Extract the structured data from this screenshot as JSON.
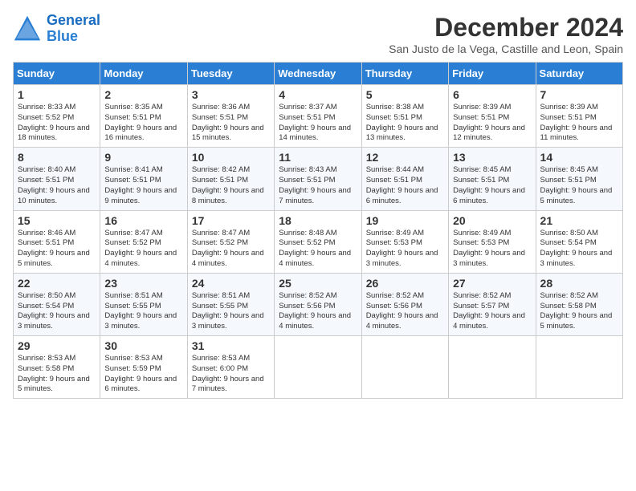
{
  "header": {
    "logo_line1": "General",
    "logo_line2": "Blue",
    "month_title": "December 2024",
    "subtitle": "San Justo de la Vega, Castille and Leon, Spain"
  },
  "columns": [
    "Sunday",
    "Monday",
    "Tuesday",
    "Wednesday",
    "Thursday",
    "Friday",
    "Saturday"
  ],
  "weeks": [
    [
      {
        "day": "1",
        "sunrise": "8:33 AM",
        "sunset": "5:52 PM",
        "daylight": "9 hours and 18 minutes."
      },
      {
        "day": "2",
        "sunrise": "8:35 AM",
        "sunset": "5:51 PM",
        "daylight": "9 hours and 16 minutes."
      },
      {
        "day": "3",
        "sunrise": "8:36 AM",
        "sunset": "5:51 PM",
        "daylight": "9 hours and 15 minutes."
      },
      {
        "day": "4",
        "sunrise": "8:37 AM",
        "sunset": "5:51 PM",
        "daylight": "9 hours and 14 minutes."
      },
      {
        "day": "5",
        "sunrise": "8:38 AM",
        "sunset": "5:51 PM",
        "daylight": "9 hours and 13 minutes."
      },
      {
        "day": "6",
        "sunrise": "8:39 AM",
        "sunset": "5:51 PM",
        "daylight": "9 hours and 12 minutes."
      },
      {
        "day": "7",
        "sunrise": "8:39 AM",
        "sunset": "5:51 PM",
        "daylight": "9 hours and 11 minutes."
      }
    ],
    [
      {
        "day": "8",
        "sunrise": "8:40 AM",
        "sunset": "5:51 PM",
        "daylight": "9 hours and 10 minutes."
      },
      {
        "day": "9",
        "sunrise": "8:41 AM",
        "sunset": "5:51 PM",
        "daylight": "9 hours and 9 minutes."
      },
      {
        "day": "10",
        "sunrise": "8:42 AM",
        "sunset": "5:51 PM",
        "daylight": "9 hours and 8 minutes."
      },
      {
        "day": "11",
        "sunrise": "8:43 AM",
        "sunset": "5:51 PM",
        "daylight": "9 hours and 7 minutes."
      },
      {
        "day": "12",
        "sunrise": "8:44 AM",
        "sunset": "5:51 PM",
        "daylight": "9 hours and 6 minutes."
      },
      {
        "day": "13",
        "sunrise": "8:45 AM",
        "sunset": "5:51 PM",
        "daylight": "9 hours and 6 minutes."
      },
      {
        "day": "14",
        "sunrise": "8:45 AM",
        "sunset": "5:51 PM",
        "daylight": "9 hours and 5 minutes."
      }
    ],
    [
      {
        "day": "15",
        "sunrise": "8:46 AM",
        "sunset": "5:51 PM",
        "daylight": "9 hours and 5 minutes."
      },
      {
        "day": "16",
        "sunrise": "8:47 AM",
        "sunset": "5:52 PM",
        "daylight": "9 hours and 4 minutes."
      },
      {
        "day": "17",
        "sunrise": "8:47 AM",
        "sunset": "5:52 PM",
        "daylight": "9 hours and 4 minutes."
      },
      {
        "day": "18",
        "sunrise": "8:48 AM",
        "sunset": "5:52 PM",
        "daylight": "9 hours and 4 minutes."
      },
      {
        "day": "19",
        "sunrise": "8:49 AM",
        "sunset": "5:53 PM",
        "daylight": "9 hours and 3 minutes."
      },
      {
        "day": "20",
        "sunrise": "8:49 AM",
        "sunset": "5:53 PM",
        "daylight": "9 hours and 3 minutes."
      },
      {
        "day": "21",
        "sunrise": "8:50 AM",
        "sunset": "5:54 PM",
        "daylight": "9 hours and 3 minutes."
      }
    ],
    [
      {
        "day": "22",
        "sunrise": "8:50 AM",
        "sunset": "5:54 PM",
        "daylight": "9 hours and 3 minutes."
      },
      {
        "day": "23",
        "sunrise": "8:51 AM",
        "sunset": "5:55 PM",
        "daylight": "9 hours and 3 minutes."
      },
      {
        "day": "24",
        "sunrise": "8:51 AM",
        "sunset": "5:55 PM",
        "daylight": "9 hours and 3 minutes."
      },
      {
        "day": "25",
        "sunrise": "8:52 AM",
        "sunset": "5:56 PM",
        "daylight": "9 hours and 4 minutes."
      },
      {
        "day": "26",
        "sunrise": "8:52 AM",
        "sunset": "5:56 PM",
        "daylight": "9 hours and 4 minutes."
      },
      {
        "day": "27",
        "sunrise": "8:52 AM",
        "sunset": "5:57 PM",
        "daylight": "9 hours and 4 minutes."
      },
      {
        "day": "28",
        "sunrise": "8:52 AM",
        "sunset": "5:58 PM",
        "daylight": "9 hours and 5 minutes."
      }
    ],
    [
      {
        "day": "29",
        "sunrise": "8:53 AM",
        "sunset": "5:58 PM",
        "daylight": "9 hours and 5 minutes."
      },
      {
        "day": "30",
        "sunrise": "8:53 AM",
        "sunset": "5:59 PM",
        "daylight": "9 hours and 6 minutes."
      },
      {
        "day": "31",
        "sunrise": "8:53 AM",
        "sunset": "6:00 PM",
        "daylight": "9 hours and 7 minutes."
      },
      null,
      null,
      null,
      null
    ]
  ]
}
